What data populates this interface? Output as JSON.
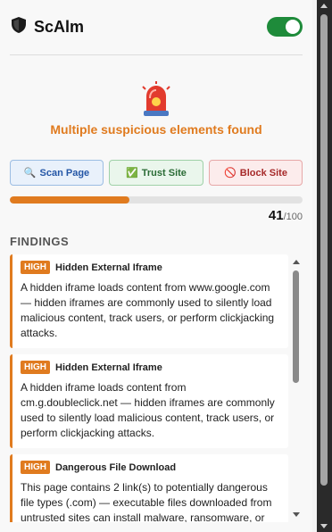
{
  "header": {
    "icon": "shield-icon",
    "title": "ScAlm",
    "toggle_on": true,
    "toggle_color": "#1e8b3a"
  },
  "status": {
    "icon": "siren-icon",
    "message": "Multiple suspicious elements found",
    "color": "#e07b1f"
  },
  "actions": {
    "scan": {
      "icon": "magnifier-icon",
      "glyph": "🔍",
      "label": "Scan Page"
    },
    "trust": {
      "icon": "check-icon",
      "glyph": "✅",
      "label": "Trust Site"
    },
    "block": {
      "icon": "no-entry-icon",
      "glyph": "🚫",
      "label": "Block Site"
    }
  },
  "risk": {
    "score": "41",
    "max": "/100",
    "fraction": 0.41
  },
  "findings_title": "FINDINGS",
  "findings": [
    {
      "severity": "HIGH",
      "title": "Hidden External Iframe",
      "description": "A hidden iframe loads content from www.google.com — hidden iframes are commonly used to silently load malicious content, track users, or perform clickjacking attacks."
    },
    {
      "severity": "HIGH",
      "title": "Hidden External Iframe",
      "description": "A hidden iframe loads content from cm.g.doubleclick.net — hidden iframes are commonly used to silently load malicious content, track users, or perform clickjacking attacks."
    },
    {
      "severity": "HIGH",
      "title": "Dangerous File Download",
      "description": "This page contains 2 link(s) to potentially dangerous file types (.com) — executable files downloaded from untrusted sites can install malware, ransomware, or"
    }
  ]
}
